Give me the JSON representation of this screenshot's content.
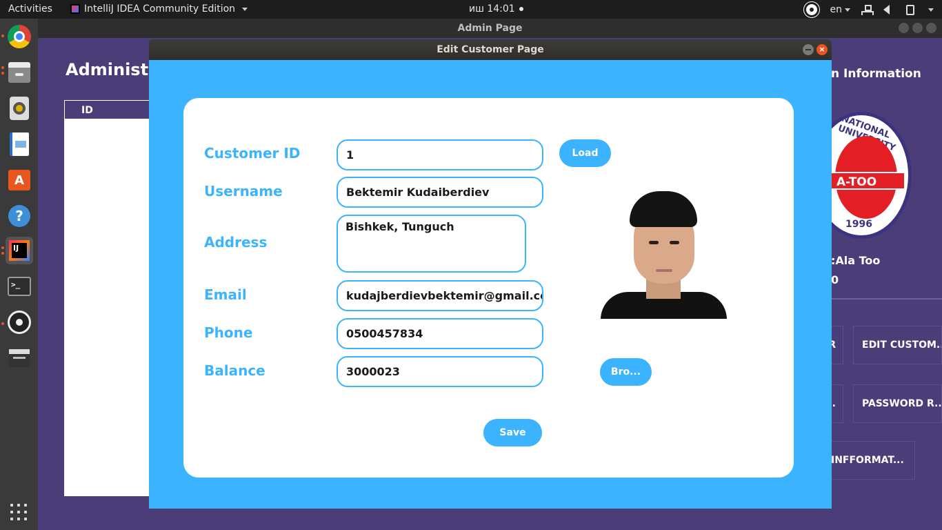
{
  "topbar": {
    "activities": "Activities",
    "app_name": "IntelliJ IDEA Community Edition",
    "clock": "иш 14:01",
    "lang": "en"
  },
  "dock": {
    "items": [
      "chrome-icon",
      "files-icon",
      "rhythmbox-icon",
      "writer-icon",
      "software-icon",
      "help-icon",
      "intellij-icon",
      "terminal-icon",
      "obs-icon",
      "video-editor-icon"
    ],
    "store_glyph": "A",
    "help_glyph": "?",
    "ij_glyph": "IJ",
    "term_glyph": ">_"
  },
  "admin": {
    "window_title": "Admin Page",
    "page_title": "Administ",
    "table_header": "ID",
    "info_title": "n Information",
    "logo_top": "NATIONAL UNIVERSITY",
    "logo_band": "A-TOO",
    "logo_year": "1996",
    "admin_name": ":Ala Too",
    "admin_value": "0",
    "buttons": {
      "b1": "R",
      "edit_customer": "EDIT CUSTOM...",
      "b2": "...",
      "password_reset": "PASSWORD R...",
      "information": "INFFORMAT..."
    }
  },
  "dialog": {
    "title": "Edit Customer Page",
    "close_glyph": "×",
    "fields": {
      "customer_id": {
        "label": "Customer ID",
        "value": "1"
      },
      "username": {
        "label": "Username",
        "value": "Bektemir Kudaiberdiev"
      },
      "address": {
        "label": "Address",
        "value": "Bishkek, Tunguch"
      },
      "email": {
        "label": "Email",
        "value": "kudajberdievbektemir@gmail.com"
      },
      "phone": {
        "label": "Phone",
        "value": "0500457834"
      },
      "balance": {
        "label": "Balance",
        "value": "3000023"
      }
    },
    "load_label": "Load",
    "browse_label": "Bro...",
    "save_label": "Save"
  },
  "colors": {
    "accent": "#3bb3ff",
    "admin_bg": "#4a3d78",
    "close_button": "#e95420"
  }
}
